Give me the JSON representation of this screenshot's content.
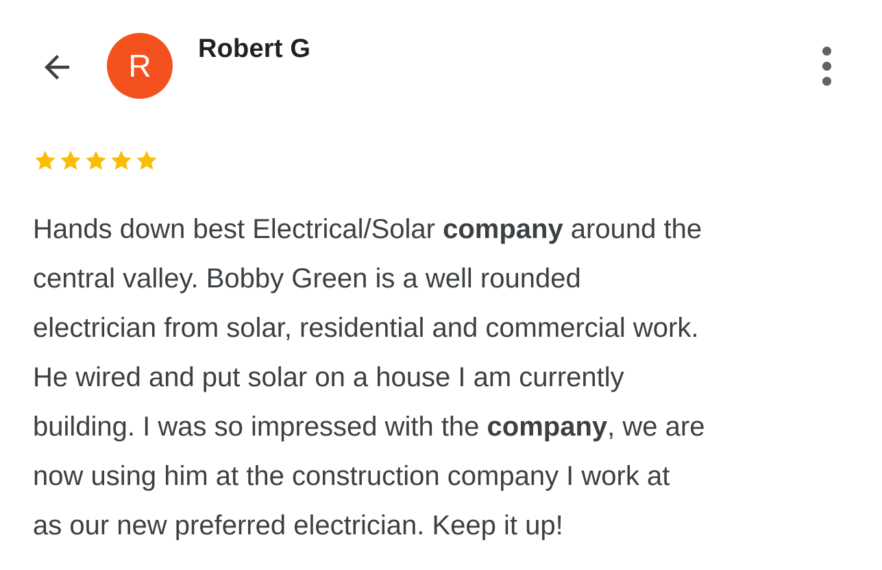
{
  "header": {
    "back_icon": "arrow-back-icon",
    "avatar_letter": "R",
    "avatar_color": "#f4511e",
    "reviewer_name": "Robert G",
    "more_icon": "more-vert-icon"
  },
  "rating": {
    "stars": 5,
    "max": 5,
    "star_color": "#fbbc04"
  },
  "review": {
    "lines": [
      [
        {
          "t": "Hands down best Electrical/Solar "
        },
        {
          "t": "company",
          "b": true
        },
        {
          "t": " around the"
        }
      ],
      [
        {
          "t": "central valley. Bobby Green is a well rounded"
        }
      ],
      [
        {
          "t": "electrician from solar, residential and commercial work."
        }
      ],
      [
        {
          "t": "He wired and put solar on a house I am currently"
        }
      ],
      [
        {
          "t": "building. I was so impressed with the "
        },
        {
          "t": "company",
          "b": true
        },
        {
          "t": ", we are"
        }
      ],
      [
        {
          "t": "now using him at the construction company I work at"
        }
      ],
      [
        {
          "t": "as our new preferred electrician. Keep it up!"
        }
      ]
    ]
  }
}
